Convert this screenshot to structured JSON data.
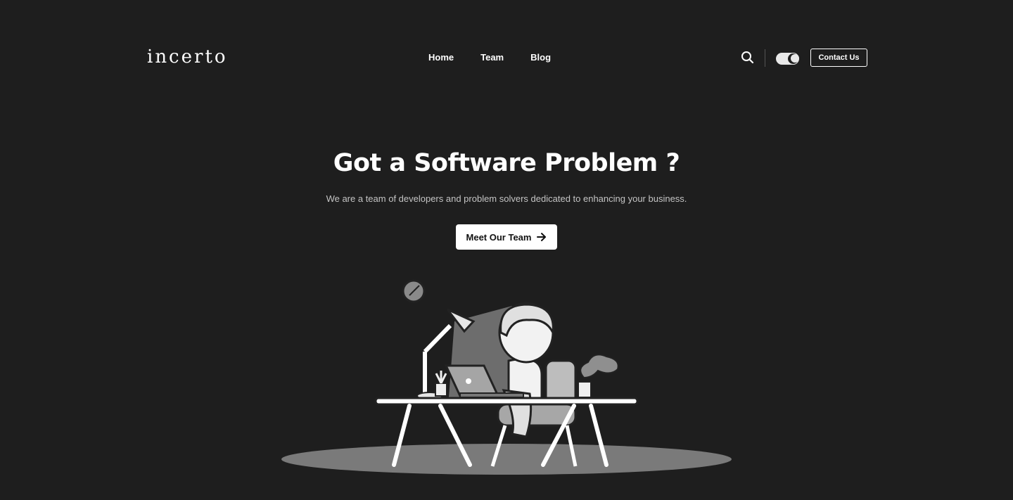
{
  "header": {
    "logo": "incerto",
    "nav": [
      {
        "label": "Home"
      },
      {
        "label": "Team"
      },
      {
        "label": "Blog"
      }
    ],
    "search_icon": "search-icon",
    "theme_toggle_icon": "moon-icon",
    "contact_label": "Contact Us"
  },
  "hero": {
    "title": "Got a Software Problem ?",
    "subtitle": "We are a team of developers and problem solvers dedicated to enhancing your business.",
    "cta_label": "Meet Our Team",
    "cta_icon": "arrow-right-icon",
    "illustration": "developer-at-desk-illustration"
  },
  "colors": {
    "background": "#1e1e1e",
    "text": "#ffffff",
    "muted_text": "#c4c4c4",
    "button_bg": "#ffffff",
    "button_text": "#111111"
  }
}
